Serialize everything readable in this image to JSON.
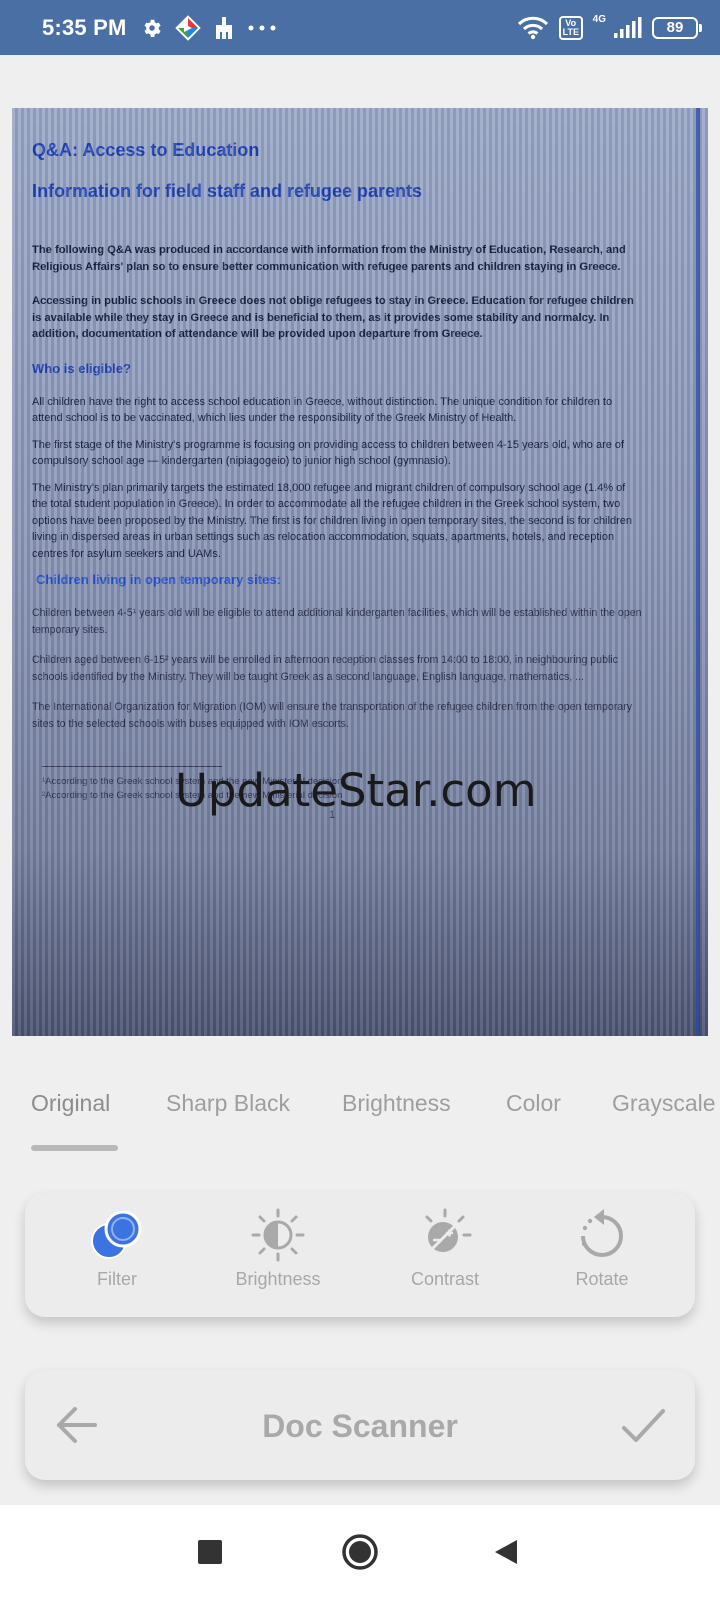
{
  "status_bar": {
    "time": "5:35 PM",
    "left_icons": [
      "gear-icon",
      "play-store-icon",
      "cleaner-icon",
      "more-dots-icon"
    ],
    "volte": "Vo LTE",
    "network": "4G",
    "battery": "89"
  },
  "document": {
    "title_1": "Q&A: Access to Education",
    "title_2": "Information for field staff and refugee parents",
    "para_1": "The following Q&A was produced in accordance with information from the Ministry of Education, Research, and Religious Affairs' plan so to ensure better communication with refugee parents and children staying in Greece.",
    "para_2": "Accessing in public schools in Greece does not oblige refugees to stay in Greece. Education for refugee children is available while they stay in Greece and is beneficial to them, as it provides some stability and normalcy. In addition, documentation of attendance will be provided upon departure from Greece.",
    "heading_1": "Who is eligible?",
    "para_3": "All children have the right to access school education in Greece, without distinction. The unique condition for children to attend school is to be vaccinated, which lies under the responsibility of the Greek Ministry of Health.",
    "para_4": "The first stage of the Ministry's programme is focusing on providing access to children between 4-15 years old, who are of compulsory school age — kindergarten (nipiagogeio) to junior high school (gymnasio).",
    "para_5": "The Ministry's plan primarily targets the estimated 18,000 refugee and migrant children of compulsory school age (1.4% of the total student population in Greece). In order to accommodate all the refugee children in the Greek school system, two options have been proposed by the Ministry. The first is for children living in open temporary sites, the second is for children living in dispersed areas in urban settings such as relocation accommodation, squats, apartments, hotels, and reception centres for asylum seekers and UAMs.",
    "heading_2": "Children living in open temporary sites:",
    "para_6": "Children between 4-5¹ years old will be eligible to attend additional kindergarten facilities, which will be established within the open temporary sites.",
    "para_7": "Children aged between 6-15² years will be enrolled in afternoon reception classes from 14:00 to 18:00, in neighbouring public schools identified by the Ministry. They will be taught Greek as a second language, English language, mathematics, ...",
    "para_8": "The International Organization for Migration (IOM) will ensure the transportation of the refugee children from the open temporary sites to the selected schools with buses equipped with IOM escorts.",
    "footnote_1": "¹According to the Greek school system and the new Ministerial decision",
    "footnote_2": "²According to the Greek school system and the new Ministerial decision",
    "page_number": "1"
  },
  "watermark": "UpdateStar.com",
  "filter_tabs": [
    "Original",
    "Sharp Black",
    "Brightness",
    "Color",
    "Grayscale"
  ],
  "active_filter_tab": "Original",
  "tools": [
    {
      "label": "Filter",
      "icon": "filter-icon",
      "active": true
    },
    {
      "label": "Brightness",
      "icon": "brightness-icon",
      "active": false
    },
    {
      "label": "Contrast",
      "icon": "contrast-icon",
      "active": false
    },
    {
      "label": "Rotate",
      "icon": "rotate-icon",
      "active": false
    }
  ],
  "bottom_bar": {
    "title": "Doc Scanner",
    "back_icon": "back-arrow-icon",
    "confirm_icon": "checkmark-icon"
  },
  "nav_bar": [
    "recents-icon",
    "home-icon",
    "back-icon"
  ],
  "colors": {
    "status_bar": "#4a6fa5",
    "accent": "#3b74e0",
    "doc_heading": "#1c3fb2",
    "muted_text": "#a8a8a8"
  }
}
